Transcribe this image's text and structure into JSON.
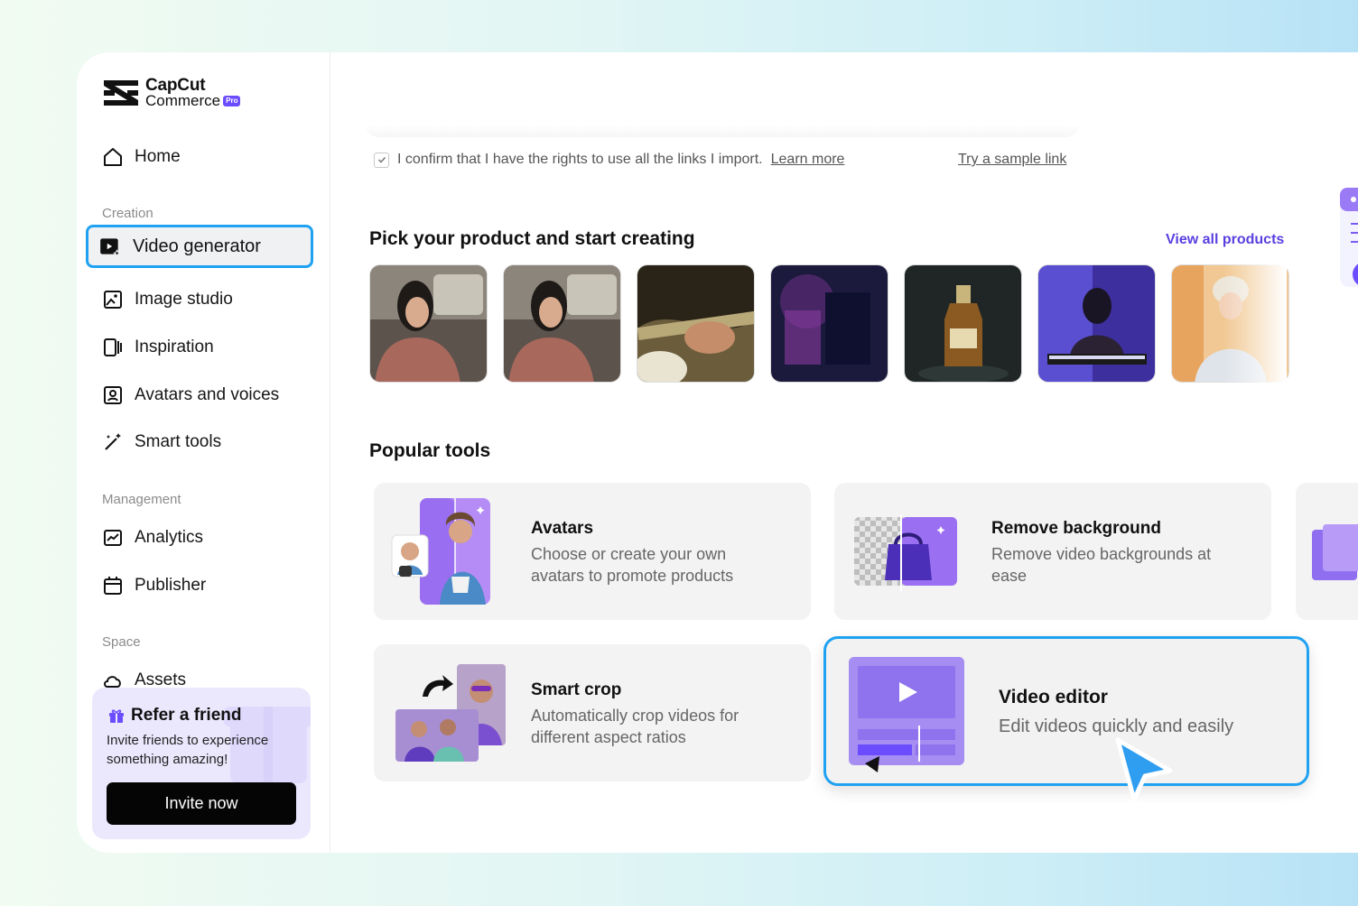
{
  "logo": {
    "line1": "CapCut",
    "line2": "Commerce",
    "badge": "Pro"
  },
  "nav": {
    "home": "Home",
    "creation_label": "Creation",
    "video_generator": "Video generator",
    "image_studio": "Image studio",
    "inspiration": "Inspiration",
    "avatars_voices": "Avatars and voices",
    "smart_tools": "Smart tools",
    "management_label": "Management",
    "analytics": "Analytics",
    "publisher": "Publisher",
    "space_label": "Space",
    "assets": "Assets"
  },
  "refer": {
    "title": "Refer a friend",
    "subtitle": "Invite friends to experience something amazing!",
    "button": "Invite now"
  },
  "confirm": {
    "text": "I confirm that I have the rights to use all the links I import.",
    "learn_more": "Learn more",
    "sample_link": "Try a sample link"
  },
  "products": {
    "heading": "Pick your product and start creating",
    "view_all": "View all products"
  },
  "tools": {
    "heading": "Popular tools",
    "items": [
      {
        "title": "Avatars",
        "desc": "Choose or create your own avatars to promote products"
      },
      {
        "title": "Remove background",
        "desc": "Remove video backgrounds at ease"
      },
      {
        "title": "Smart crop",
        "desc": "Automatically crop videos for different aspect ratios"
      },
      {
        "title": "Video editor",
        "desc": "Edit videos quickly and easily"
      }
    ]
  },
  "colors": {
    "accent": "#1fa2f1",
    "brand": "#6b4dff",
    "purple_tile": "#9b7af5"
  }
}
